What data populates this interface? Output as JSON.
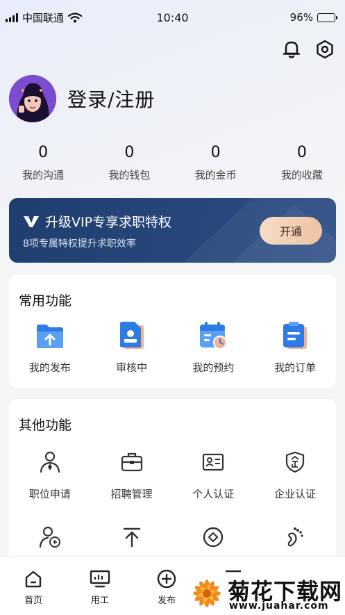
{
  "status_bar": {
    "carrier": "中国联通",
    "time": "10:40",
    "battery": "96%",
    "battery_level": 0.96
  },
  "header": {
    "icons": [
      "bell-icon",
      "settings-hexagon-icon"
    ]
  },
  "profile": {
    "login_label": "登录/注册"
  },
  "stats": [
    {
      "value": "0",
      "label": "我的沟通"
    },
    {
      "value": "0",
      "label": "我的钱包"
    },
    {
      "value": "0",
      "label": "我的金币"
    },
    {
      "value": "0",
      "label": "我的收藏"
    }
  ],
  "vip": {
    "title": "升级VIP专享求职特权",
    "subtitle": "8项专属特权提升求职效率",
    "button": "开通"
  },
  "common": {
    "title": "常用功能",
    "items": [
      {
        "label": "我的发布",
        "icon": "folder-upload-icon"
      },
      {
        "label": "审核中",
        "icon": "review-document-icon"
      },
      {
        "label": "我的预约",
        "icon": "calendar-clock-icon"
      },
      {
        "label": "我的订单",
        "icon": "order-clipboard-icon"
      }
    ]
  },
  "other": {
    "title": "其他功能",
    "items": [
      {
        "label": "职位申请",
        "icon": "person-tie-icon"
      },
      {
        "label": "招聘管理",
        "icon": "briefcase-icon"
      },
      {
        "label": "个人认证",
        "icon": "id-card-icon"
      },
      {
        "label": "企业认证",
        "icon": "enterprise-shield-icon"
      },
      {
        "label": "",
        "icon": "person-agent-icon"
      },
      {
        "label": "",
        "icon": "upload-top-icon"
      },
      {
        "label": "",
        "icon": "coin-icon"
      },
      {
        "label": "",
        "icon": "footprint-icon"
      }
    ]
  },
  "tabbar": [
    {
      "label": "首页",
      "icon": "home-icon"
    },
    {
      "label": "用工",
      "icon": "monitor-icon"
    },
    {
      "label": "发布",
      "icon": "plus-circle-icon"
    }
  ],
  "watermark": {
    "text": "菊花下载网",
    "url": "www.juahar.com"
  },
  "colors": {
    "vip_bg": "#1f3e6e",
    "accent_blue": "#2f7be6",
    "vip_button": "#f2cfb4"
  }
}
